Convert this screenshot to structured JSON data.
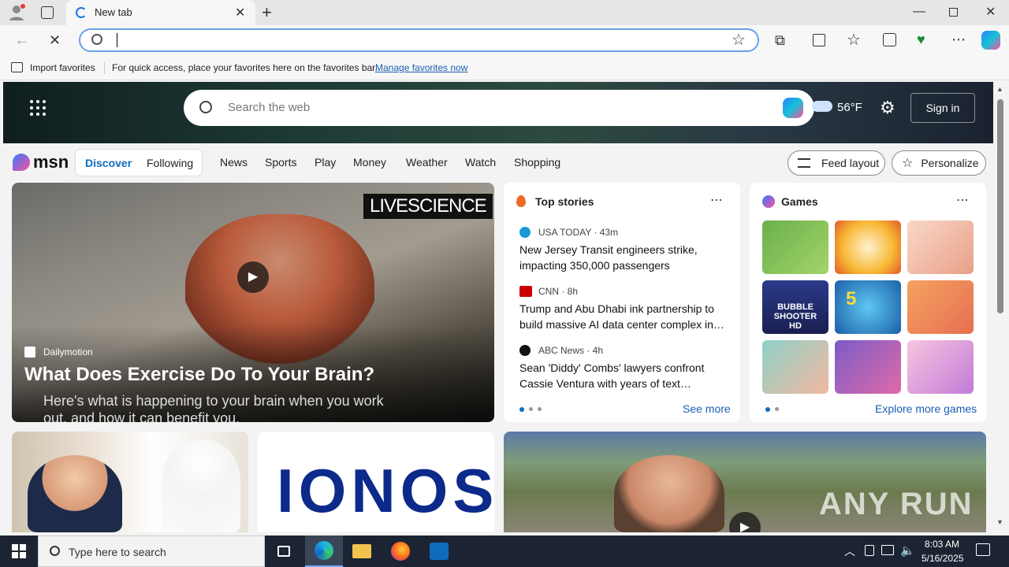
{
  "browser": {
    "tab_title": "New tab",
    "address_value": "",
    "favorites": {
      "import_label": "Import favorites",
      "hint": "For quick access, place your favorites here on the favorites bar.",
      "manage_link": "Manage favorites now"
    }
  },
  "msn": {
    "search_placeholder": "Search the web",
    "temperature": "56°F",
    "sign_in": "Sign in",
    "logo_text": "msn",
    "tabs": [
      "Discover",
      "Following"
    ],
    "nav": [
      "News",
      "Sports",
      "Play",
      "Money",
      "Weather",
      "Watch",
      "Shopping"
    ],
    "feed_layout": "Feed layout",
    "personalize": "Personalize"
  },
  "hero_video": {
    "badge": "LIVESCIENCE",
    "source": "Dailymotion",
    "title": "What Does Exercise Do To Your Brain?",
    "subtitle": "Here's what is happening to your brain when you work out, and how it can benefit you."
  },
  "top_stories": {
    "header": "Top stories",
    "items": [
      {
        "source": "USA TODAY · 43m",
        "headline": "New Jersey Transit engineers strike, impacting 350,000 passengers"
      },
      {
        "source": "CNN · 8h",
        "headline": "Trump and Abu Dhabi ink partnership to build massive AI data center complex in…"
      },
      {
        "source": "ABC News · 4h",
        "headline": "Sean 'Diddy' Combs' lawyers confront Cassie Ventura with years of text…"
      }
    ],
    "see_more": "See more"
  },
  "games": {
    "header": "Games",
    "tile_text": [
      "BUBBLE SHOOTER HD",
      "5"
    ],
    "explore": "Explore more games"
  },
  "bottom": {
    "ionos": "IONOS",
    "watermark": "ANY RUN"
  },
  "taskbar": {
    "search_placeholder": "Type here to search",
    "time": "8:03 AM",
    "date": "5/16/2025"
  },
  "colors": {
    "accent": "#0f6cbd",
    "link": "#1a5fb4",
    "taskbar": "#1c2433"
  }
}
